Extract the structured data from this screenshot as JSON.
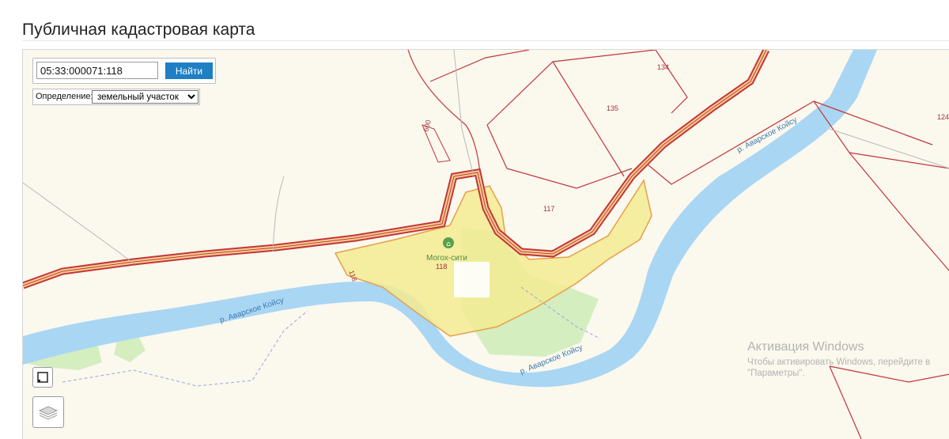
{
  "page": {
    "title": "Публичная кадастровая карта"
  },
  "search": {
    "value": "05:33:000071:118",
    "button_label": "Найти"
  },
  "definition": {
    "label": "Определение:",
    "options": [
      "земельный участок"
    ],
    "selected": "земельный участок"
  },
  "map": {
    "parcel_labels": [
      "134",
      "135",
      "124",
      "117",
      "118"
    ],
    "road_label": "600",
    "poi_name": "Могох-сити",
    "selected_parcel_label": "118",
    "river_label": "р. Аварское Койсу",
    "colors": {
      "background": "#fbf8ee",
      "river": "#a9d6f3",
      "parcel_border": "#c2363a",
      "selected_fill": "#f3eb92",
      "selected_border": "#e6a04a",
      "forest": "#d4eec0",
      "poi": "#5aa04a"
    }
  },
  "controls": {
    "fullscreen_icon": "fullscreen-icon",
    "layers_icon": "layers-icon"
  },
  "watermark": {
    "title": "Активация Windows",
    "line1": "Чтобы активировать Windows, перейдите в",
    "line2": "\"Параметры\"."
  }
}
